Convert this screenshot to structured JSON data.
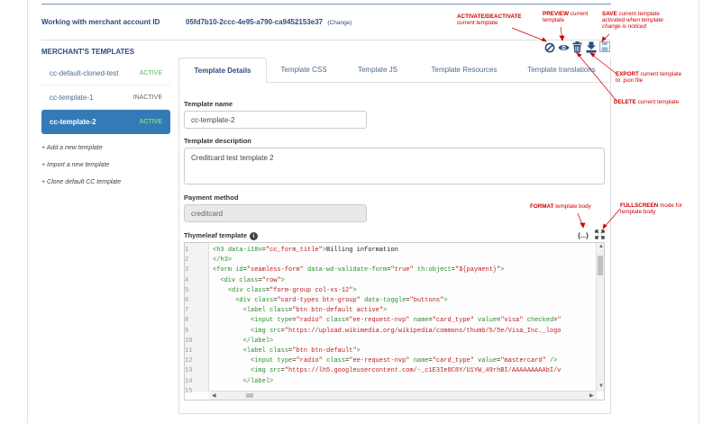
{
  "header": {
    "merchant_label": "Working with merchant account ID",
    "merchant_id": "05fd7b10-2ccc-4e95-a790-ca9452153e37",
    "change_link": "(Change)"
  },
  "sidebar": {
    "title": "MERCHANT'S TEMPLATES",
    "templates": [
      {
        "name": "cc-default-cloned-test",
        "status": "ACTIVE"
      },
      {
        "name": "cc-template-1",
        "status": "INACTIVE"
      },
      {
        "name": "cc-template-2",
        "status": "ACTIVE"
      }
    ],
    "actions": [
      "+ Add a new template",
      "+ Import a new template",
      "+ Clone default CC template"
    ]
  },
  "tabs": [
    "Template Details",
    "Template CSS",
    "Template JS",
    "Template Resources",
    "Template translations"
  ],
  "form": {
    "name_label": "Template name",
    "name_value": "cc-template-2",
    "description_label": "Template description",
    "description_value": "Creditcard test template 2",
    "payment_label": "Payment method",
    "payment_value": "creditcard",
    "thymeleaf_label": "Thymeleaf template"
  },
  "editor": {
    "line_numbers": [
      "1",
      "2",
      "3",
      "4",
      "5",
      "6",
      "7",
      "8",
      "9",
      "10",
      "11",
      "12",
      "13",
      "14",
      "15"
    ]
  },
  "toolbar": {
    "icons": [
      "ban-icon",
      "eye-icon",
      "trash-icon",
      "export-icon",
      "save-icon"
    ],
    "format_icon": "{...}",
    "fullscreen_icon": "expand-icon"
  },
  "annotations": {
    "activate_bold": "ACTIVATE/DEACTIVATE",
    "activate_rest": "current template",
    "preview_bold": "PREVIEW",
    "preview_rest": "current template",
    "save_bold": "SAVE",
    "save_rest": "current template",
    "save_note": "activated when template change is noticed",
    "export_bold": "EXPORT",
    "export_rest": "current template to .json file",
    "delete_bold": "DELETE",
    "delete_rest": "current template",
    "format_bold": "FORMAT",
    "format_rest": "template body",
    "fullscreen_bold": "FULLSCREEN",
    "fullscreen_rest": "mode for template body"
  },
  "colors": {
    "accent": "#337ab7",
    "active_green": "#5cb85c",
    "annotation_red": "#cc0000",
    "header_blue": "#2b4c7e"
  }
}
